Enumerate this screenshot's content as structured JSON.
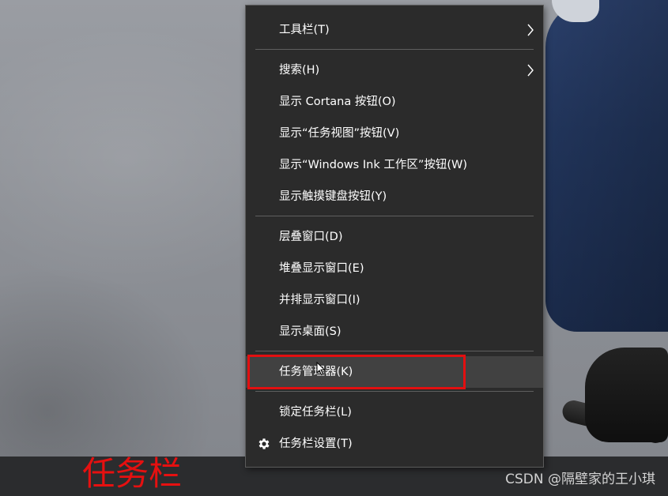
{
  "context_menu": {
    "items": [
      {
        "label": "工具栏(T)",
        "has_submenu": true
      },
      {
        "label": "搜索(H)",
        "has_submenu": true
      },
      {
        "label": "显示 Cortana 按钮(O)"
      },
      {
        "label": "显示“任务视图”按钮(V)"
      },
      {
        "label": "显示“Windows Ink 工作区”按钮(W)"
      },
      {
        "label": "显示触摸键盘按钮(Y)"
      },
      {
        "label": "层叠窗口(D)"
      },
      {
        "label": "堆叠显示窗口(E)"
      },
      {
        "label": "并排显示窗口(I)"
      },
      {
        "label": "显示桌面(S)"
      },
      {
        "label": "任务管理器(K)",
        "highlighted": true
      },
      {
        "label": "锁定任务栏(L)"
      },
      {
        "label": "任务栏设置(T)",
        "icon": "gear-icon"
      }
    ]
  },
  "annotation": {
    "taskbar_label": "任务栏",
    "highlight_color": "#e30f10"
  },
  "watermark": "CSDN @隔壁家的王小琪",
  "colors": {
    "menu_bg": "#2b2b2b",
    "menu_text": "#ffffff",
    "hover_bg": "#414141",
    "taskbar_bg": "#2b2c2e"
  }
}
